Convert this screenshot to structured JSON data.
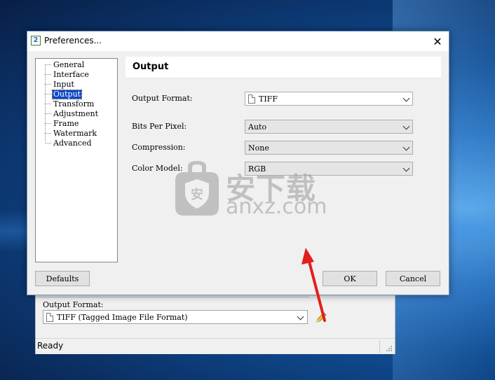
{
  "dialog": {
    "title": "Preferences...",
    "close_symbol": "✕",
    "app_icon_text": "2"
  },
  "tree": {
    "items": [
      {
        "label": "General",
        "selected": false
      },
      {
        "label": "Interface",
        "selected": false
      },
      {
        "label": "Input",
        "selected": false
      },
      {
        "label": "Output",
        "selected": true
      },
      {
        "label": "Transform",
        "selected": false
      },
      {
        "label": "Adjustment",
        "selected": false
      },
      {
        "label": "Frame",
        "selected": false
      },
      {
        "label": "Watermark",
        "selected": false
      },
      {
        "label": "Advanced",
        "selected": false
      }
    ]
  },
  "panel": {
    "header": "Output",
    "output_format": {
      "label": "Output Format:",
      "value": "TIFF"
    },
    "bits_per_pixel": {
      "label": "Bits Per Pixel:",
      "value": "Auto"
    },
    "compression": {
      "label": "Compression:",
      "value": "None"
    },
    "color_model": {
      "label": "Color Model:",
      "value": "RGB"
    }
  },
  "buttons": {
    "defaults": "Defaults",
    "ok": "OK",
    "cancel": "Cancel"
  },
  "background_window": {
    "output_format_label": "Output Format:",
    "output_format_value": "TIFF (Tagged Image File Format)",
    "status": "Ready"
  },
  "watermark": {
    "cn_text": "安下载",
    "en_text": "anxz.com"
  },
  "colors": {
    "selection": "#0a47c9",
    "arrow": "#e0201c"
  }
}
